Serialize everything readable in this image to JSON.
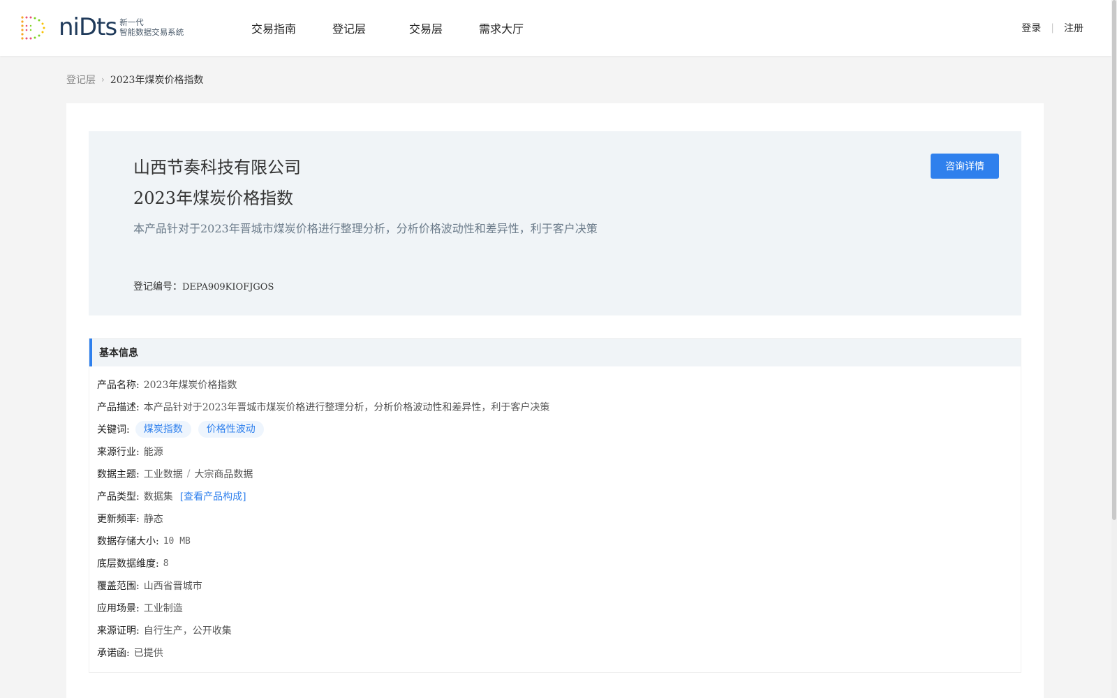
{
  "header": {
    "logo": {
      "word": "niDts",
      "sub_line1": "新一代",
      "sub_line2": "智能数据交易系统"
    },
    "nav": [
      {
        "label": "交易指南"
      },
      {
        "label": "登记层"
      },
      {
        "label": "交易层"
      },
      {
        "label": "需求大厅"
      }
    ],
    "login_label": "登录",
    "separator": "|",
    "register_label": "注册"
  },
  "breadcrumb": {
    "parent": "登记层",
    "current": "2023年煤炭价格指数"
  },
  "hero": {
    "company": "山西节奏科技有限公司",
    "title": "2023年煤炭价格指数",
    "description": "本产品针对于2023年晋城市煤炭价格进行整理分析，分析价格波动性和差异性，利于客户决策",
    "reg_label": "登记编号：",
    "reg_value": "DEPA909KIOFJGOS",
    "consult_button": "咨询详情"
  },
  "basic_info": {
    "heading": "基本信息",
    "product_name": {
      "label": "产品名称:",
      "value": "2023年煤炭价格指数"
    },
    "product_desc": {
      "label": "产品描述:",
      "value": "本产品针对于2023年晋城市煤炭价格进行整理分析，分析价格波动性和差异性，利于客户决策"
    },
    "keywords": {
      "label": "关键词:",
      "tags": [
        "煤炭指数",
        "价格性波动"
      ]
    },
    "industry": {
      "label": "来源行业:",
      "value": "能源"
    },
    "theme": {
      "label": "数据主题:",
      "value1": "工业数据",
      "slash": "/",
      "value2": "大宗商品数据"
    },
    "product_type": {
      "label": "产品类型:",
      "value": "数据集",
      "link": "[查看产品构成]"
    },
    "frequency": {
      "label": "更新频率:",
      "value": "静态"
    },
    "storage": {
      "label": "数据存储大小:",
      "value": "10 MB"
    },
    "dimension": {
      "label": "底层数据维度:",
      "value": "8"
    },
    "coverage": {
      "label": "覆盖范围:",
      "value": "山西省晋城市"
    },
    "scenario": {
      "label": "应用场景:",
      "value": "工业制造"
    },
    "source_proof": {
      "label": "来源证明:",
      "value": "自行生产，公开收集"
    },
    "commitment": {
      "label": "承诺函:",
      "value": "已提供"
    }
  }
}
